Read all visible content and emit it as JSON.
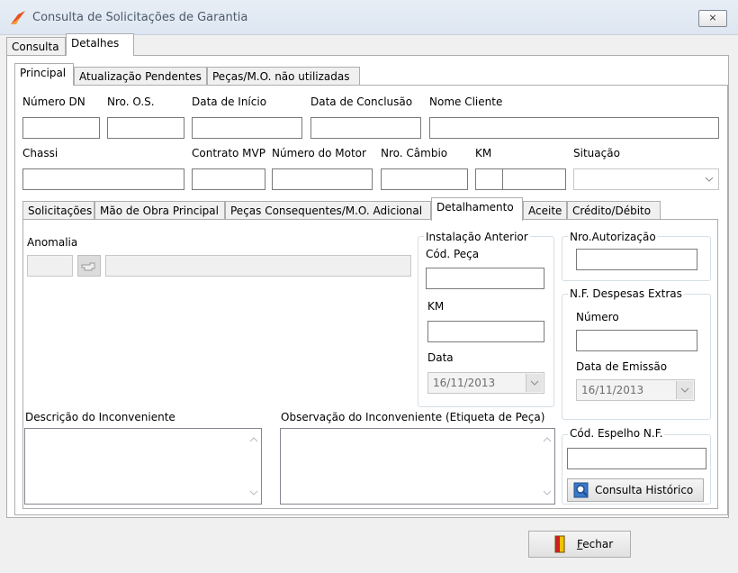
{
  "window": {
    "title": "Consulta de Solicitações de Garantia",
    "close_glyph": "⨯"
  },
  "outer_tabs": [
    {
      "label": "Consulta"
    },
    {
      "label": "Detalhes"
    }
  ],
  "inner_tabs": [
    {
      "label": "Principal"
    },
    {
      "label": "Atualização Pendentes"
    },
    {
      "label": "Peças/M.O. não utilizadas"
    }
  ],
  "principal": {
    "numero_dn": "Número DN",
    "nro_os": "Nro. O.S.",
    "data_inicio": "Data de Início",
    "data_conclusao": "Data de Conclusão",
    "nome_cliente": "Nome Cliente",
    "chassi": "Chassi",
    "contrato_mvp": "Contrato MVP",
    "numero_motor": "Número do Motor",
    "nro_cambio": "Nro. Câmbio",
    "km": "KM",
    "situacao": "Situação"
  },
  "sub_tabs": [
    {
      "label": "Solicitações"
    },
    {
      "label": "Mão de Obra Principal"
    },
    {
      "label": "Peças Consequentes/M.O. Adicional"
    },
    {
      "label": "Detalhamento"
    },
    {
      "label": "Aceite"
    },
    {
      "label": "Crédito/Débito"
    }
  ],
  "detalhamento": {
    "anomalia": "Anomalia",
    "instalacao_anterior": {
      "title": "Instalação Anterior",
      "cod_peca": "Cód. Peça",
      "km": "KM",
      "data": "Data",
      "data_value": "16/11/2013"
    },
    "nro_autorizacao": "Nro.Autorização",
    "nf_despesas": {
      "title": "N.F. Despesas Extras",
      "numero": "Número",
      "data_emissao": "Data de Emissão",
      "data_value": "16/11/2013"
    },
    "descricao": "Descrição do Inconveniente",
    "observacao": "Observação do Inconveniente (Etiqueta de Peça)",
    "cod_espelho": "Cód. Espelho N.F.",
    "consulta_historico": "Consulta Histórico"
  },
  "footer": {
    "fechar": "Fechar"
  },
  "colors": {
    "accent": "#e8501f",
    "title_text": "#4b5a6b",
    "border": "#adadad"
  },
  "icons": [
    "app-logo-icon",
    "close-icon",
    "hand-pointer-icon",
    "chevron-down-icon",
    "search-history-icon",
    "exit-door-icon"
  ]
}
